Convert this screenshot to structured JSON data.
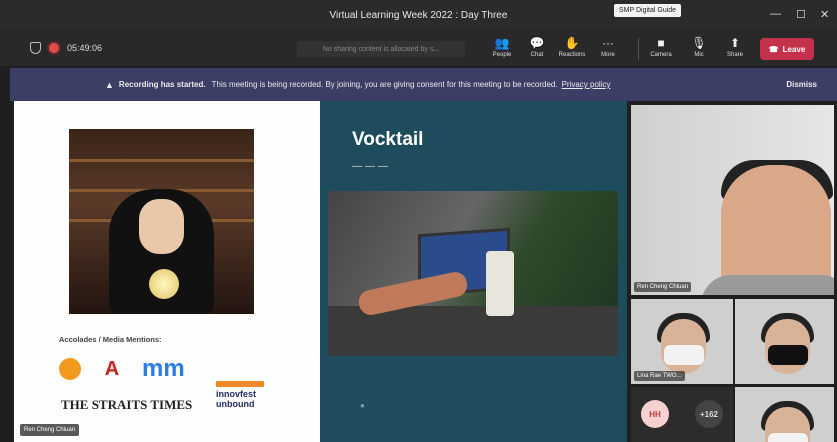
{
  "window": {
    "title": "Virtual Learning Week 2022 : Day Three",
    "tooltip": "SMP Digital Guide"
  },
  "toolbar": {
    "timer": "05:49:06",
    "share_message": "No sharing content is allocated by s...",
    "controls": [
      {
        "label": "People",
        "icon": "people-icon",
        "glyph": "👥"
      },
      {
        "label": "Chat",
        "icon": "chat-icon",
        "glyph": "💬"
      },
      {
        "label": "Reactions",
        "icon": "reactions-icon",
        "glyph": "✋"
      },
      {
        "label": "More",
        "icon": "more-icon",
        "glyph": "···"
      },
      {
        "label": "Camera",
        "icon": "camera-icon",
        "glyph": "■"
      },
      {
        "label": "Mic",
        "icon": "mic-icon",
        "glyph": "🎙"
      },
      {
        "label": "Share",
        "icon": "share-icon",
        "glyph": "⬆"
      }
    ],
    "leave_label": "Leave"
  },
  "banner": {
    "bold": "Recording has started.",
    "text": "This meeting is being recorded. By joining, you are giving consent for this meeting to be recorded.",
    "link": "Privacy policy",
    "dismiss": "Dismiss"
  },
  "slide_left": {
    "accolades": "Accolades / Media Mentions:",
    "logos": [
      "mm",
      "innovfest unbound"
    ],
    "paper": "THE STRAITS TIMES"
  },
  "slide_mid": {
    "title": "Vocktail",
    "dashes": "———"
  },
  "participants": {
    "main_name": "Ren Cheng Chiuan",
    "tile2_name": "Lina Rae TWO...",
    "avatar1": "HH",
    "avatar2": "+162"
  },
  "presenter_name": "Ren Cheng Chiuan",
  "colors": {
    "banner": "#3d3e66",
    "leave": "#c4314b",
    "slide_bg": "#1f4c5c"
  }
}
